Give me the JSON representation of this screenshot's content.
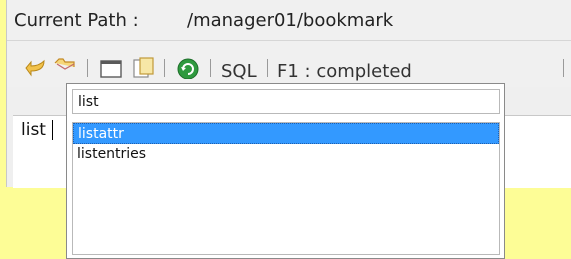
{
  "path_bar": {
    "label": "Current Path :",
    "value": "/manager01/bookmark"
  },
  "toolbar": {
    "icons": {
      "undo": "undo-arrow-icon",
      "open": "open-folder-icon",
      "window": "window-icon",
      "copy": "copy-document-icon",
      "refresh": "green-refresh-icon"
    },
    "sql_label": "SQL",
    "status_text": "F1 : completed"
  },
  "editor": {
    "text": "list"
  },
  "autocomplete": {
    "input_value": "list",
    "items": [
      "listattr",
      "listentries"
    ],
    "selected_index": 0,
    "selected_color": "#3399ff"
  }
}
